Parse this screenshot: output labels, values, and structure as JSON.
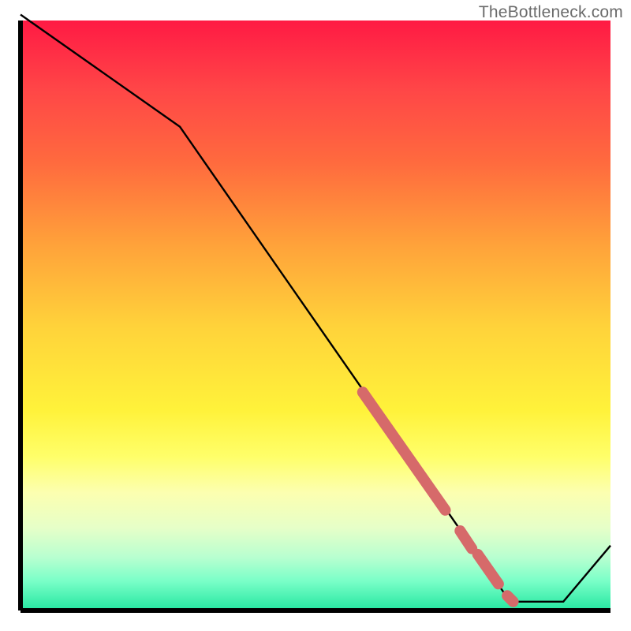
{
  "watermark": "TheBottleneck.com",
  "chart_data": {
    "type": "line",
    "title": "",
    "xlabel": "",
    "ylabel": "",
    "xlim": [
      0,
      100
    ],
    "ylim": [
      0,
      100
    ],
    "series": [
      {
        "name": "curve",
        "points": [
          {
            "x": 0,
            "y": 101
          },
          {
            "x": 27,
            "y": 82
          },
          {
            "x": 83,
            "y": 1.5
          },
          {
            "x": 92,
            "y": 1.5
          },
          {
            "x": 100,
            "y": 11
          }
        ]
      }
    ],
    "highlights": [
      {
        "x0": 58,
        "y0": 37,
        "x1": 72,
        "y1": 17,
        "thick": true
      },
      {
        "x0": 74.5,
        "y0": 13.5,
        "x1": 76.5,
        "y1": 10.5,
        "thick": true
      },
      {
        "x0": 77.5,
        "y0": 9.5,
        "x1": 81,
        "y1": 4.5,
        "thick": true
      },
      {
        "x0": 82.5,
        "y0": 2.5,
        "x1": 83.5,
        "y1": 1.5,
        "thick": true
      }
    ],
    "highlight_color": "#d66a6a"
  }
}
